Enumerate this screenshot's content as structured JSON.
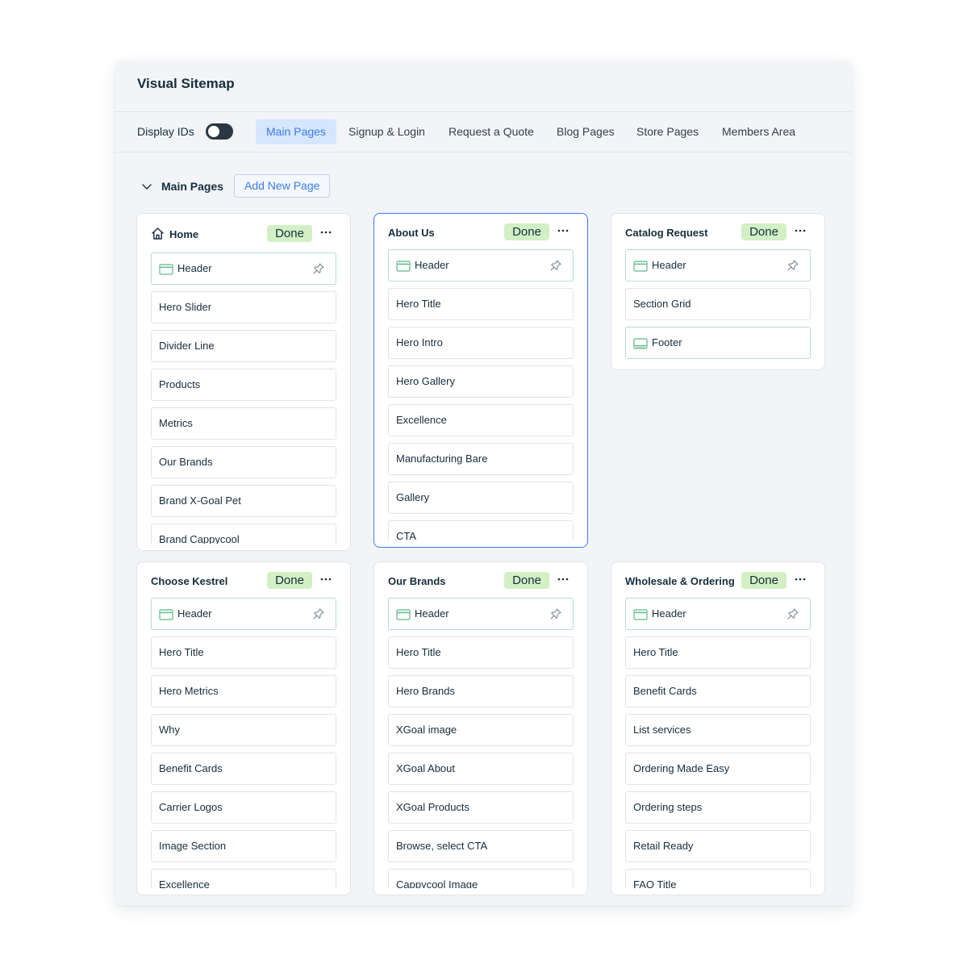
{
  "app": {
    "title": "Visual Sitemap"
  },
  "toolbar": {
    "display_ids_label": "Display IDs",
    "display_ids_on": false,
    "tabs": [
      {
        "label": "Main Pages",
        "active": true
      },
      {
        "label": "Signup & Login",
        "active": false
      },
      {
        "label": "Request a Quote",
        "active": false
      },
      {
        "label": "Blog Pages",
        "active": false
      },
      {
        "label": "Store Pages",
        "active": false
      },
      {
        "label": "Members Area",
        "active": false
      }
    ]
  },
  "section": {
    "title": "Main Pages",
    "add_label": "Add New Page"
  },
  "colors": {
    "accent": "#3b7be8",
    "done": "#d2f0c4",
    "layout_icon": "#5fb98a"
  },
  "cards": [
    {
      "title": "Home",
      "status": "Done",
      "icon": "home-icon",
      "selected": false,
      "items": [
        {
          "label": "Header",
          "type": "header"
        },
        {
          "label": "Hero Slider"
        },
        {
          "label": "Divider Line"
        },
        {
          "label": "Products"
        },
        {
          "label": "Metrics"
        },
        {
          "label": "Our Brands"
        },
        {
          "label": "Brand X-Goal Pet"
        },
        {
          "label": "Brand Cappycool"
        }
      ]
    },
    {
      "title": "About Us",
      "status": "Done",
      "selected": true,
      "items": [
        {
          "label": "Header",
          "type": "header"
        },
        {
          "label": "Hero Title"
        },
        {
          "label": "Hero Intro"
        },
        {
          "label": "Hero Gallery"
        },
        {
          "label": "Excellence"
        },
        {
          "label": "Manufacturing Bare"
        },
        {
          "label": "Gallery"
        },
        {
          "label": "CTA"
        }
      ]
    },
    {
      "title": "Catalog Request",
      "status": "Done",
      "selected": false,
      "items": [
        {
          "label": "Header",
          "type": "header"
        },
        {
          "label": "Section Grid"
        },
        {
          "label": "Footer",
          "type": "footer"
        }
      ]
    },
    {
      "title": "Choose Kestrel",
      "status": "Done",
      "selected": false,
      "items": [
        {
          "label": "Header",
          "type": "header"
        },
        {
          "label": "Hero Title"
        },
        {
          "label": "Hero Metrics"
        },
        {
          "label": "Why"
        },
        {
          "label": "Benefit Cards"
        },
        {
          "label": "Carrier Logos"
        },
        {
          "label": "Image Section"
        },
        {
          "label": "Excellence"
        }
      ]
    },
    {
      "title": "Our Brands",
      "status": "Done",
      "selected": false,
      "items": [
        {
          "label": "Header",
          "type": "header"
        },
        {
          "label": "Hero Title"
        },
        {
          "label": "Hero Brands"
        },
        {
          "label": "XGoal image"
        },
        {
          "label": "XGoal About"
        },
        {
          "label": "XGoal Products"
        },
        {
          "label": "Browse, select CTA"
        },
        {
          "label": "Cappycool Image"
        }
      ]
    },
    {
      "title": "Wholesale & Ordering",
      "status": "Done",
      "selected": false,
      "items": [
        {
          "label": "Header",
          "type": "header"
        },
        {
          "label": "Hero Title"
        },
        {
          "label": "Benefit Cards"
        },
        {
          "label": "List services"
        },
        {
          "label": "Ordering Made Easy"
        },
        {
          "label": "Ordering steps"
        },
        {
          "label": "Retail Ready"
        },
        {
          "label": "FAQ Title"
        }
      ]
    }
  ]
}
